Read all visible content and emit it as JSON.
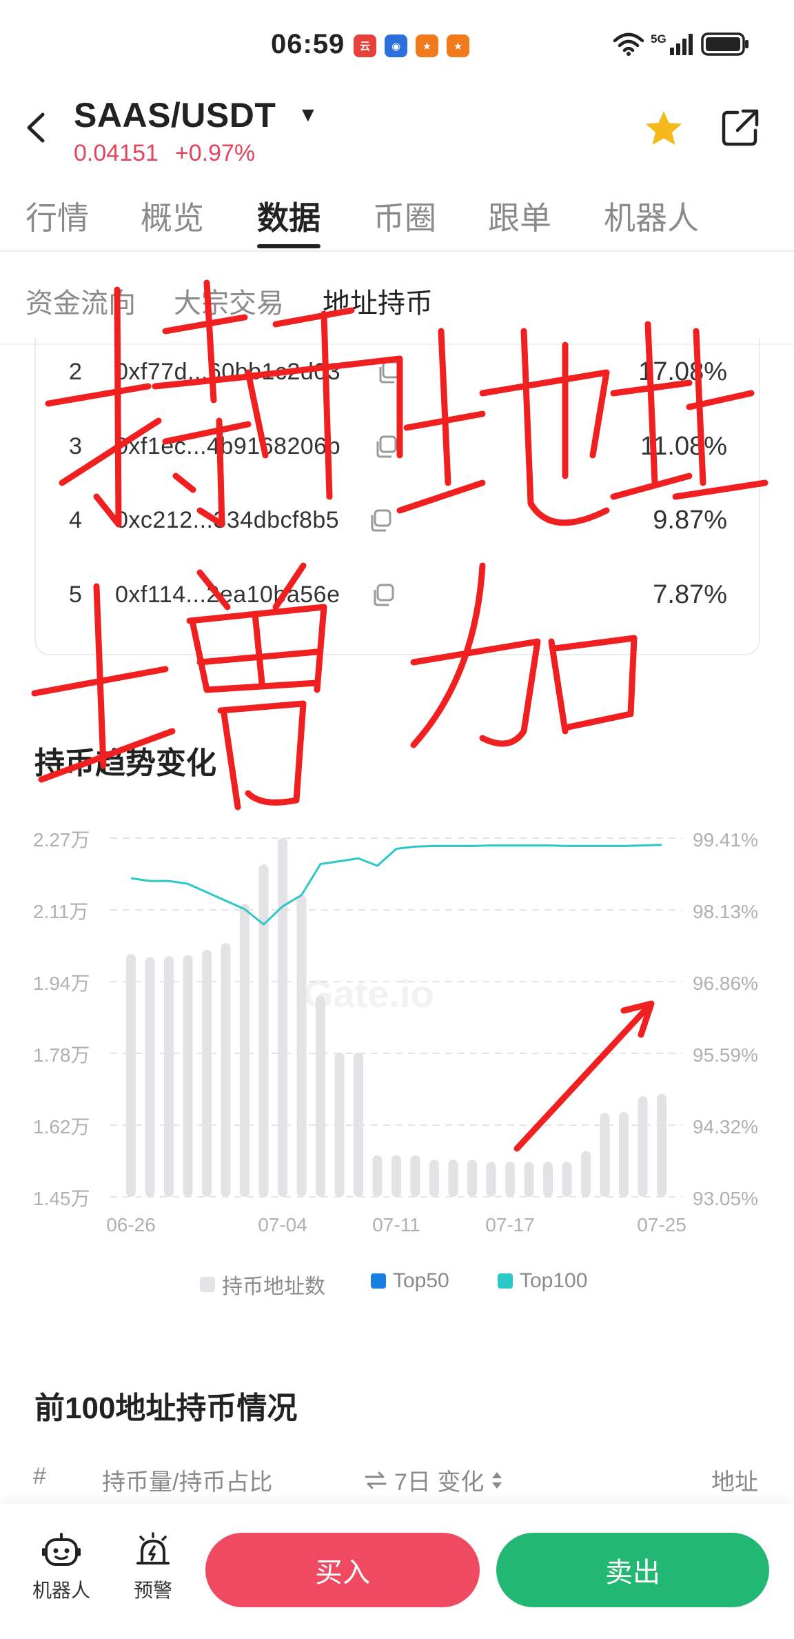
{
  "status_bar": {
    "time": "06:59",
    "network": "5G",
    "app_icons": [
      {
        "name": "news-app-icon",
        "color": "#e8403a",
        "glyph": "云"
      },
      {
        "name": "browser-app-icon",
        "color": "#2a6fdc",
        "glyph": "◉"
      },
      {
        "name": "game-app-icon-1",
        "color": "#f07a1c",
        "glyph": "★"
      },
      {
        "name": "game-app-icon-2",
        "color": "#f07a1c",
        "glyph": "★"
      }
    ]
  },
  "header": {
    "pair": "SAAS/USDT",
    "price": "0.04151",
    "change": "+0.97%",
    "accent_color": "#e2455c",
    "star_color": "#f6b91c"
  },
  "main_tabs": [
    {
      "label": "行情",
      "active": false
    },
    {
      "label": "概览",
      "active": false
    },
    {
      "label": "数据",
      "active": true
    },
    {
      "label": "币圈",
      "active": false
    },
    {
      "label": "跟单",
      "active": false
    },
    {
      "label": "机器人",
      "active": false
    }
  ],
  "sub_tabs": [
    {
      "label": "资金流向",
      "active": false
    },
    {
      "label": "大宗交易",
      "active": false
    },
    {
      "label": "地址持币",
      "active": true
    }
  ],
  "holders": [
    {
      "rank": "2",
      "address": "0xf77d...60bb1c2d03",
      "pct": "17.08%"
    },
    {
      "rank": "3",
      "address": "0xf1ec...4b9168206b",
      "pct": "11.08%"
    },
    {
      "rank": "4",
      "address": "0xc212...334dbcf8b5",
      "pct": "9.87%"
    },
    {
      "rank": "5",
      "address": "0xf114...2ea10ba56e",
      "pct": "7.87%"
    }
  ],
  "trend_section": {
    "title": "持币趋势变化",
    "watermark": "Gate.io"
  },
  "chart_data": {
    "type": "bar",
    "title": "",
    "x_tick_labels": [
      "06-26",
      "07-04",
      "07-11",
      "07-17",
      "07-25"
    ],
    "x_tick_index": [
      0,
      8,
      14,
      20,
      28
    ],
    "y_left_ticks": [
      "2.27万",
      "2.11万",
      "1.94万",
      "1.78万",
      "1.62万",
      "1.45万"
    ],
    "y_left_range": [
      14500,
      22700
    ],
    "y_right_ticks": [
      "99.41%",
      "98.13%",
      "96.86%",
      "95.59%",
      "94.32%",
      "93.05%"
    ],
    "y_right_range": [
      93.05,
      99.41
    ],
    "grid": true,
    "legend_position": "bottom",
    "series": [
      {
        "name": "持币地址数",
        "type": "bar",
        "axis": "left",
        "color": "#e3e3e6",
        "values": [
          20050,
          19980,
          20000,
          20030,
          20150,
          20300,
          21200,
          22100,
          22700,
          21400,
          19100,
          17800,
          17800,
          15450,
          15450,
          15450,
          15350,
          15350,
          15350,
          15300,
          15300,
          15300,
          15300,
          15300,
          15550,
          16420,
          16440,
          16800,
          16850
        ]
      },
      {
        "name": "Top50",
        "type": "line",
        "axis": "right",
        "color": "#1a7fe0",
        "values": []
      },
      {
        "name": "Top100",
        "type": "line",
        "axis": "right",
        "color": "#2cc8c8",
        "values": [
          98.7,
          98.65,
          98.65,
          98.6,
          98.45,
          98.3,
          98.15,
          97.88,
          98.2,
          98.4,
          98.95,
          99.0,
          99.05,
          98.92,
          99.22,
          99.26,
          99.27,
          99.27,
          99.27,
          99.28,
          99.28,
          99.28,
          99.28,
          99.27,
          99.27,
          99.27,
          99.27,
          99.28,
          99.29
        ]
      }
    ]
  },
  "top100_section": {
    "title": "前100地址持币情况",
    "columns": {
      "rank": "#",
      "amount": "持币量/持币占比",
      "change": "7日 变化",
      "address": "地址"
    }
  },
  "bottom_bar": {
    "robot_label": "机器人",
    "alert_label": "预警",
    "buy_label": "买入",
    "sell_label": "卖出"
  },
  "annotation": {
    "handwriting": "持币地址增加",
    "ink_color": "#f02020"
  }
}
